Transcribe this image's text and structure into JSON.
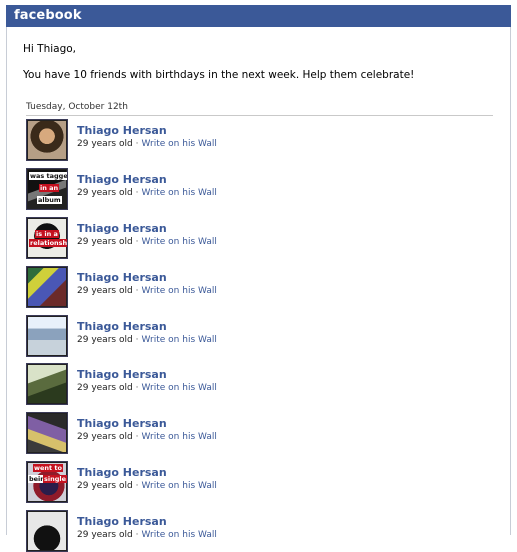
{
  "header": {
    "brand": "facebook"
  },
  "greeting": "Hi Thiago,",
  "intro": "You have 10 friends with birthdays in the next week. Help them celebrate!",
  "date_header": "Tuesday, October 12th",
  "friends": [
    {
      "name": "Thiago Hersan",
      "age": "29 years old",
      "separator": "·",
      "wall": "Write on his Wall",
      "thumb": "portrait-photo"
    },
    {
      "name": "Thiago Hersan",
      "age": "29 years old",
      "separator": "·",
      "wall": "Write on his Wall",
      "thumb": "tagged-album-photo",
      "tag_lines": [
        "was tagged",
        "in an",
        "album"
      ]
    },
    {
      "name": "Thiago Hersan",
      "age": "29 years old",
      "separator": "·",
      "wall": "Write on his Wall",
      "thumb": "relationship-photo",
      "tag_lines": [
        "is in a",
        "relationship"
      ]
    },
    {
      "name": "Thiago Hersan",
      "age": "29 years old",
      "separator": "·",
      "wall": "Write on his Wall",
      "thumb": "colorful-photo"
    },
    {
      "name": "Thiago Hersan",
      "age": "29 years old",
      "separator": "·",
      "wall": "Write on his Wall",
      "thumb": "snow-photo"
    },
    {
      "name": "Thiago Hersan",
      "age": "29 years old",
      "separator": "·",
      "wall": "Write on his Wall",
      "thumb": "outdoor-photo"
    },
    {
      "name": "Thiago Hersan",
      "age": "29 years old",
      "separator": "·",
      "wall": "Write on his Wall",
      "thumb": "abstract-photo"
    },
    {
      "name": "Thiago Hersan",
      "age": "29 years old",
      "separator": "·",
      "wall": "Write on his Wall",
      "thumb": "single-photo",
      "tag_lines": [
        "went to",
        "being",
        "single"
      ]
    },
    {
      "name": "Thiago Hersan",
      "age": "29 years old",
      "separator": "·",
      "wall": "Write on his Wall",
      "thumb": "silhouette-photo"
    }
  ],
  "colors": {
    "brand": "#3b5998",
    "link": "#3b5998",
    "tag": "#c4111f"
  }
}
